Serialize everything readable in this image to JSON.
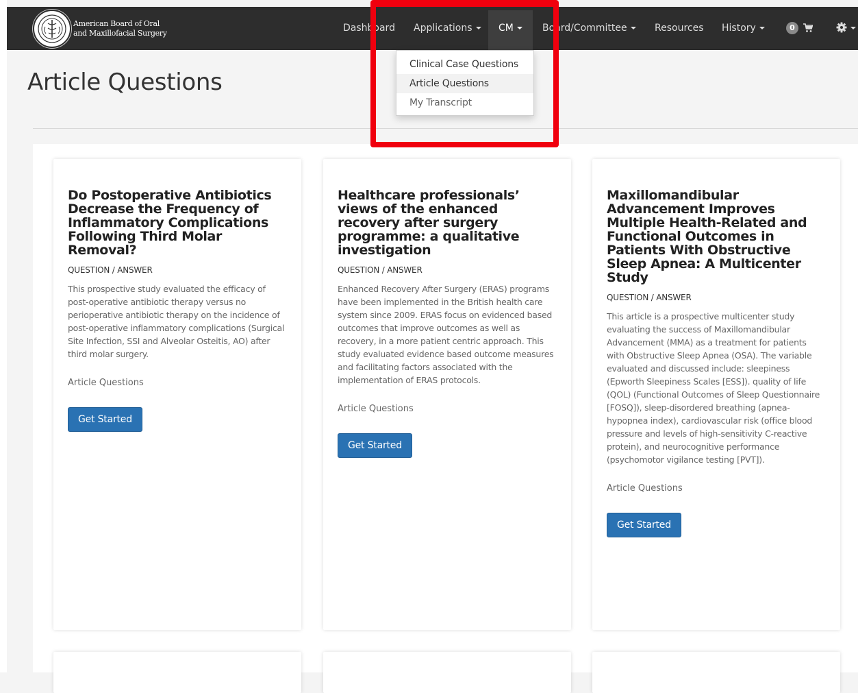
{
  "navbar": {
    "brand_line1": "American Board of Oral",
    "brand_line2": "and Maxillofacial Surgery",
    "items": [
      {
        "label": "Dashboard"
      },
      {
        "label": "Applications"
      },
      {
        "label": "CM"
      },
      {
        "label": "Board/Committee"
      },
      {
        "label": "Resources"
      },
      {
        "label": "History"
      }
    ],
    "cart_count": "0"
  },
  "dropdown": {
    "items": [
      {
        "label": "Clinical Case Questions"
      },
      {
        "label": "Article Questions"
      },
      {
        "label": "My Transcript"
      }
    ]
  },
  "page": {
    "title": "Article Questions"
  },
  "cards": [
    {
      "title": "Do Postoperative Antibiotics Decrease the Frequency of Inflammatory Complications Following Third Molar Removal?",
      "type": "QUESTION / ANSWER",
      "description": "This prospective study evaluated the efficacy of post-operative antibiotic therapy versus no perioperative antibiotic therapy on the incidence of post-operative inflammatory complications (Surgical Site Infection, SSI and Alveolar Osteitis, AO) after third molar surgery.",
      "category": "Article Questions",
      "button": "Get Started"
    },
    {
      "title": "Healthcare professionals’ views of the enhanced recovery after surgery programme: a qualitative investigation",
      "type": "QUESTION / ANSWER",
      "description": "Enhanced Recovery After Surgery (ERAS) programs have been implemented in the British health care system since 2009. ERAS focus on evidenced based outcomes that improve outcomes as well as recovery, in a more patient centric approach. This study evaluated evidence based outcome measures and facilitating factors associated with the implementation of ERAS protocols.",
      "category": "Article Questions",
      "button": "Get Started"
    },
    {
      "title": "Maxillomandibular Advancement Improves Multiple Health-Related and Functional Outcomes in Patients With Obstructive Sleep Apnea: A Multicenter Study",
      "type": "QUESTION / ANSWER",
      "description": "This article is a prospective multicenter study evaluating the success of Maxillomandibular Advancement (MMA) as a treatment for patients with Obstructive Sleep Apnea (OSA). The variable evaluated and discussed include: sleepiness (Epworth Sleepiness Scales [ESS]). quality of life (QOL) (Functional Outcomes of Sleep Questionnaire [FOSQ]), sleep-disordered breathing (apnea-hypopnea index), cardiovascular risk (office blood pressure and levels of high-sensitivity C-reactive protein), and neurocognitive performance (psychomotor vigilance testing [PVT]).",
      "category": "Article Questions",
      "button": "Get Started"
    }
  ],
  "colors": {
    "navbar_bg": "#2d2d2d",
    "accent_button": "#2a72b3",
    "annotation_red": "#f0000e"
  }
}
